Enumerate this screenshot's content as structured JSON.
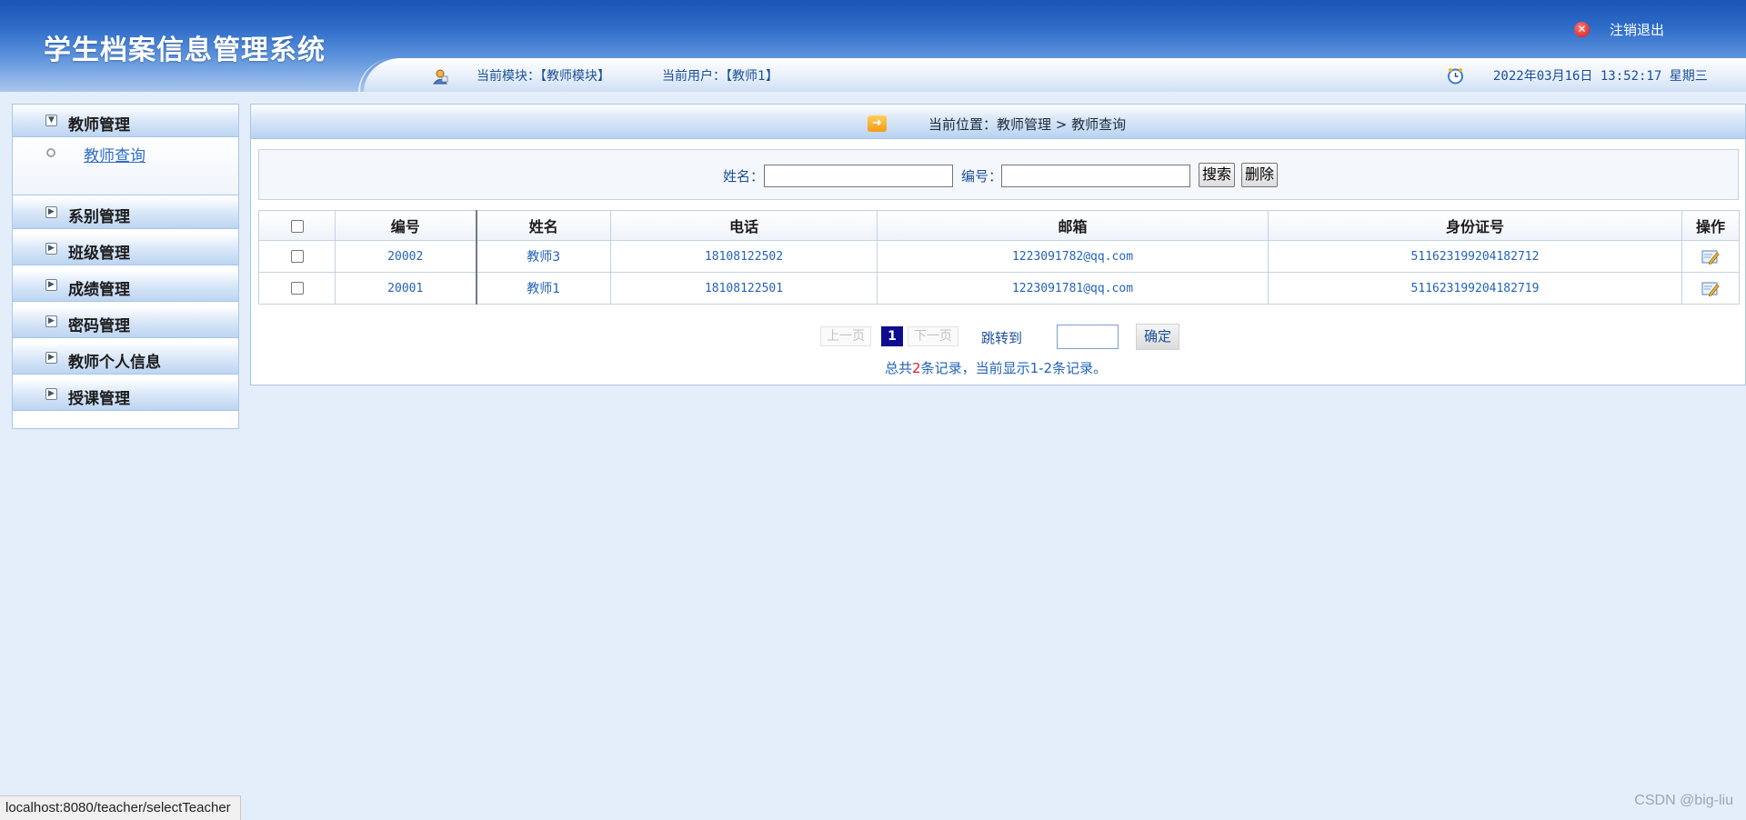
{
  "header": {
    "app_title": "学生档案信息管理系统",
    "logout_label": "注销退出",
    "current_module": "当前模块：【教师模块】",
    "current_user": "当前用户：【教师1】",
    "datetime": "2022年03月16日 13:52:17 星期三"
  },
  "sidebar": {
    "sections": [
      {
        "label": "教师管理",
        "expanded": true,
        "items": [
          "教师查询"
        ]
      },
      {
        "label": "系别管理",
        "expanded": false
      },
      {
        "label": "班级管理",
        "expanded": false
      },
      {
        "label": "成绩管理",
        "expanded": false
      },
      {
        "label": "密码管理",
        "expanded": false
      },
      {
        "label": "教师个人信息",
        "expanded": false
      },
      {
        "label": "授课管理",
        "expanded": false
      }
    ]
  },
  "breadcrumb": {
    "text": "当前位置：教师管理 > 教师查询"
  },
  "search": {
    "name_label": "姓名：",
    "name_value": "",
    "id_label": "编号：",
    "id_value": "",
    "search_button": "搜索",
    "delete_button": "删除"
  },
  "table": {
    "columns": [
      "编号",
      "姓名",
      "电话",
      "邮箱",
      "身份证号",
      "操作"
    ],
    "rows": [
      {
        "id": "20002",
        "name": "教师3",
        "phone": "18108122502",
        "email": "1223091782@qq.com",
        "idcard": "511623199204182712"
      },
      {
        "id": "20001",
        "name": "教师1",
        "phone": "18108122501",
        "email": "1223091781@qq.com",
        "idcard": "511623199204182719"
      }
    ]
  },
  "pager": {
    "prev": "上一页",
    "current_page": "1",
    "next": "下一页",
    "jump_label": "跳转到",
    "jump_value": "",
    "confirm": "确定",
    "summary_prefix": "总共",
    "summary_count": "2",
    "summary_suffix": "条记录，当前显示1-2条记录。"
  },
  "status_bar": {
    "url": "localhost:8080/teacher/selectTeacher"
  },
  "watermark": "CSDN @big-liu",
  "colors": {
    "header_blue": "#1b55b5",
    "link_blue": "#2363b8",
    "page_bg": "#e4eefb",
    "current_page_bg": "#0d0d8f"
  }
}
